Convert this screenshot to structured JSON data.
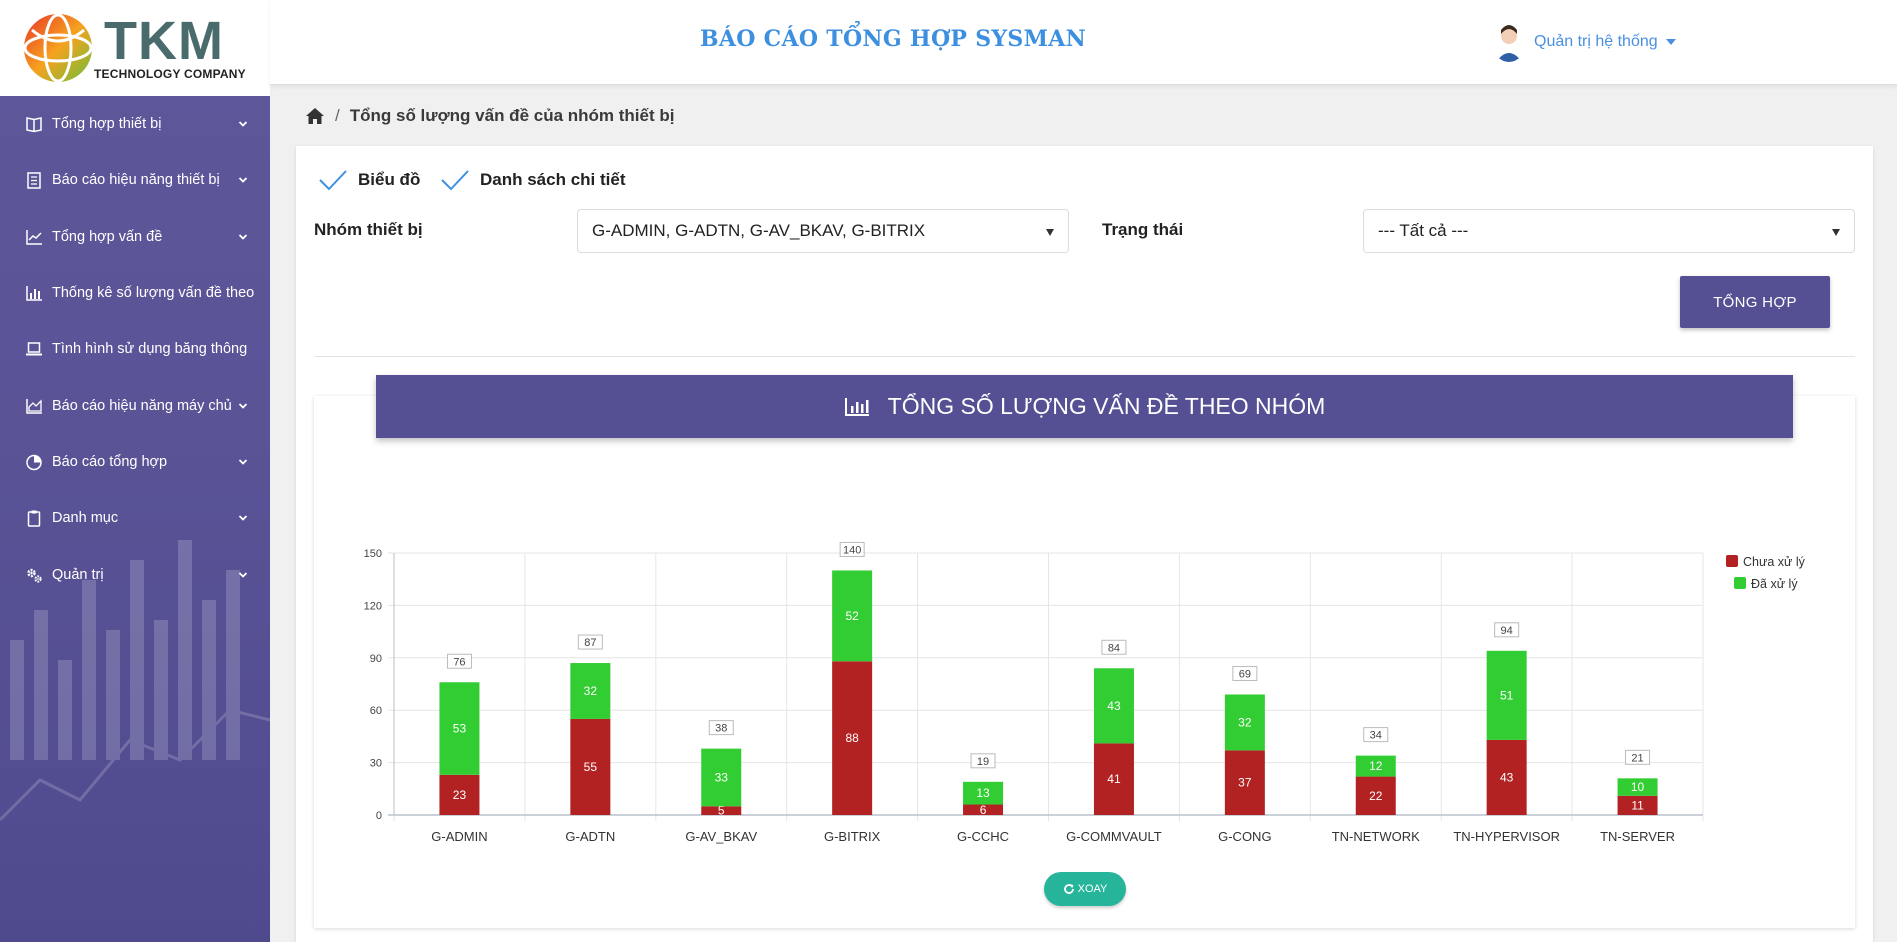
{
  "brand": {
    "name": "TKM",
    "subtitle": "TECHNOLOGY COMPANY"
  },
  "sidebar": {
    "items": [
      {
        "label": "Tổng hợp thiết bị",
        "icon": "book-icon",
        "has_submenu": true
      },
      {
        "label": "Báo cáo hiệu năng thiết bị",
        "icon": "list-icon",
        "has_submenu": true
      },
      {
        "label": "Tổng hợp vấn đề",
        "icon": "line-chart-icon",
        "has_submenu": true
      },
      {
        "label": "Thống kê số lượng vấn đề theo",
        "icon": "bar-chart-icon",
        "has_submenu": false
      },
      {
        "label": "Tình hình sử dụng băng thông",
        "icon": "laptop-icon",
        "has_submenu": false
      },
      {
        "label": "Báo cáo hiệu năng máy chủ",
        "icon": "area-chart-icon",
        "has_submenu": true
      },
      {
        "label": "Báo cáo tổng hợp",
        "icon": "pie-chart-icon",
        "has_submenu": true
      },
      {
        "label": "Danh mục",
        "icon": "clipboard-icon",
        "has_submenu": true
      },
      {
        "label": "Quản trị",
        "icon": "gears-icon",
        "has_submenu": true
      }
    ]
  },
  "header": {
    "title": "BÁO CÁO TỔNG HỢP SYSMAN",
    "user_name": "Quản trị hệ thống"
  },
  "breadcrumb": {
    "current": "Tổng số lượng vấn đề của nhóm thiết bị"
  },
  "options": {
    "chart_label": "Biểu đồ",
    "list_label": "Danh sách chi tiết"
  },
  "filters": {
    "group_label": "Nhóm thiết bị",
    "group_value": "G-ADMIN, G-ADTN, G-AV_BKAV, G-BITRIX",
    "status_label": "Trạng thái",
    "status_value": "--- Tất cả ---"
  },
  "buttons": {
    "summarize": "TỔNG HỢP",
    "rotate": "XOAY"
  },
  "chart_section": {
    "title": "TỔNG SỐ LƯỢNG VẤN ĐỀ THEO NHÓM"
  },
  "colors": {
    "accent": "#554f93",
    "unprocessed": "#b22222",
    "processed": "#32cd32",
    "rotate_button": "#26b59a",
    "title_blue": "#3d8fe0"
  },
  "chart_data": {
    "type": "bar",
    "stacked": true,
    "categories": [
      "G-ADMIN",
      "G-ADTN",
      "G-AV_BKAV",
      "G-BITRIX",
      "G-CCHC",
      "G-COMMVAULT",
      "G-CONG",
      "TN-NETWORK",
      "TN-HYPERVISOR",
      "TN-SERVER"
    ],
    "series": [
      {
        "name": "Chưa xử lý",
        "color": "#b22222",
        "values": [
          23,
          55,
          5,
          88,
          6,
          41,
          37,
          22,
          43,
          11
        ]
      },
      {
        "name": "Đã xử lý",
        "color": "#32cd32",
        "values": [
          53,
          32,
          33,
          52,
          13,
          43,
          32,
          12,
          51,
          10
        ]
      }
    ],
    "totals": [
      76,
      87,
      38,
      140,
      19,
      84,
      69,
      34,
      94,
      21
    ],
    "ylim": [
      0,
      150
    ],
    "yticks": [
      0,
      30,
      60,
      90,
      120,
      150
    ],
    "grid": true,
    "legend": "top-right"
  }
}
